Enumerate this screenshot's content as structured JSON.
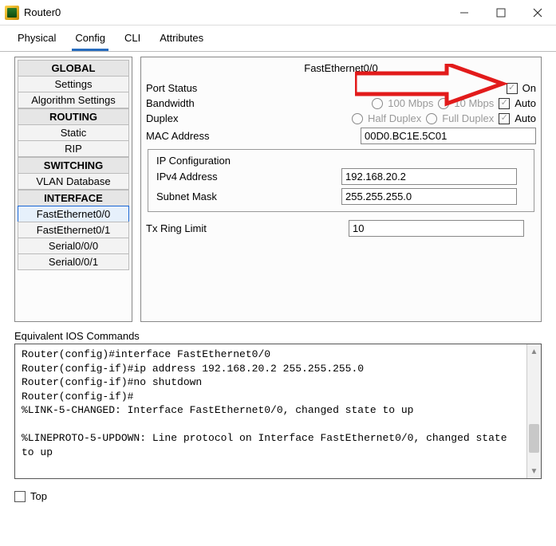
{
  "window": {
    "title": "Router0"
  },
  "tabs": [
    "Physical",
    "Config",
    "CLI",
    "Attributes"
  ],
  "tabs_active_index": 1,
  "sidebar": {
    "global": {
      "header": "GLOBAL",
      "items": [
        "Settings",
        "Algorithm Settings"
      ]
    },
    "routing": {
      "header": "ROUTING",
      "items": [
        "Static",
        "RIP"
      ]
    },
    "switching": {
      "header": "SWITCHING",
      "items": [
        "VLAN Database"
      ]
    },
    "interface": {
      "header": "INTERFACE",
      "items": [
        "FastEthernet0/0",
        "FastEthernet0/1",
        "Serial0/0/0",
        "Serial0/0/1"
      ],
      "selected_index": 0
    }
  },
  "panel": {
    "title": "FastEthernet0/0",
    "port_status": {
      "label": "Port Status",
      "on_label": "On",
      "on_checked": true
    },
    "bandwidth": {
      "label": "Bandwidth",
      "opt1": "100 Mbps",
      "opt2": "10 Mbps",
      "auto_label": "Auto",
      "auto_checked": true
    },
    "duplex": {
      "label": "Duplex",
      "opt1": "Half Duplex",
      "opt2": "Full Duplex",
      "auto_label": "Auto",
      "auto_checked": true
    },
    "mac": {
      "label": "MAC Address",
      "value": "00D0.BC1E.5C01"
    },
    "ip": {
      "title": "IP Configuration",
      "ipv4_label": "IPv4 Address",
      "ipv4_value": "192.168.20.2",
      "mask_label": "Subnet Mask",
      "mask_value": "255.255.255.0"
    },
    "txring": {
      "label": "Tx Ring Limit",
      "value": "10"
    }
  },
  "ios": {
    "label": "Equivalent IOS Commands",
    "text": "Router(config)#interface FastEthernet0/0\nRouter(config-if)#ip address 192.168.20.2 255.255.255.0\nRouter(config-if)#no shutdown\nRouter(config-if)#\n%LINK-5-CHANGED: Interface FastEthernet0/0, changed state to up\n\n%LINEPROTO-5-UPDOWN: Line protocol on Interface FastEthernet0/0, changed state to up"
  },
  "footer": {
    "top_label": "Top",
    "top_checked": false
  }
}
